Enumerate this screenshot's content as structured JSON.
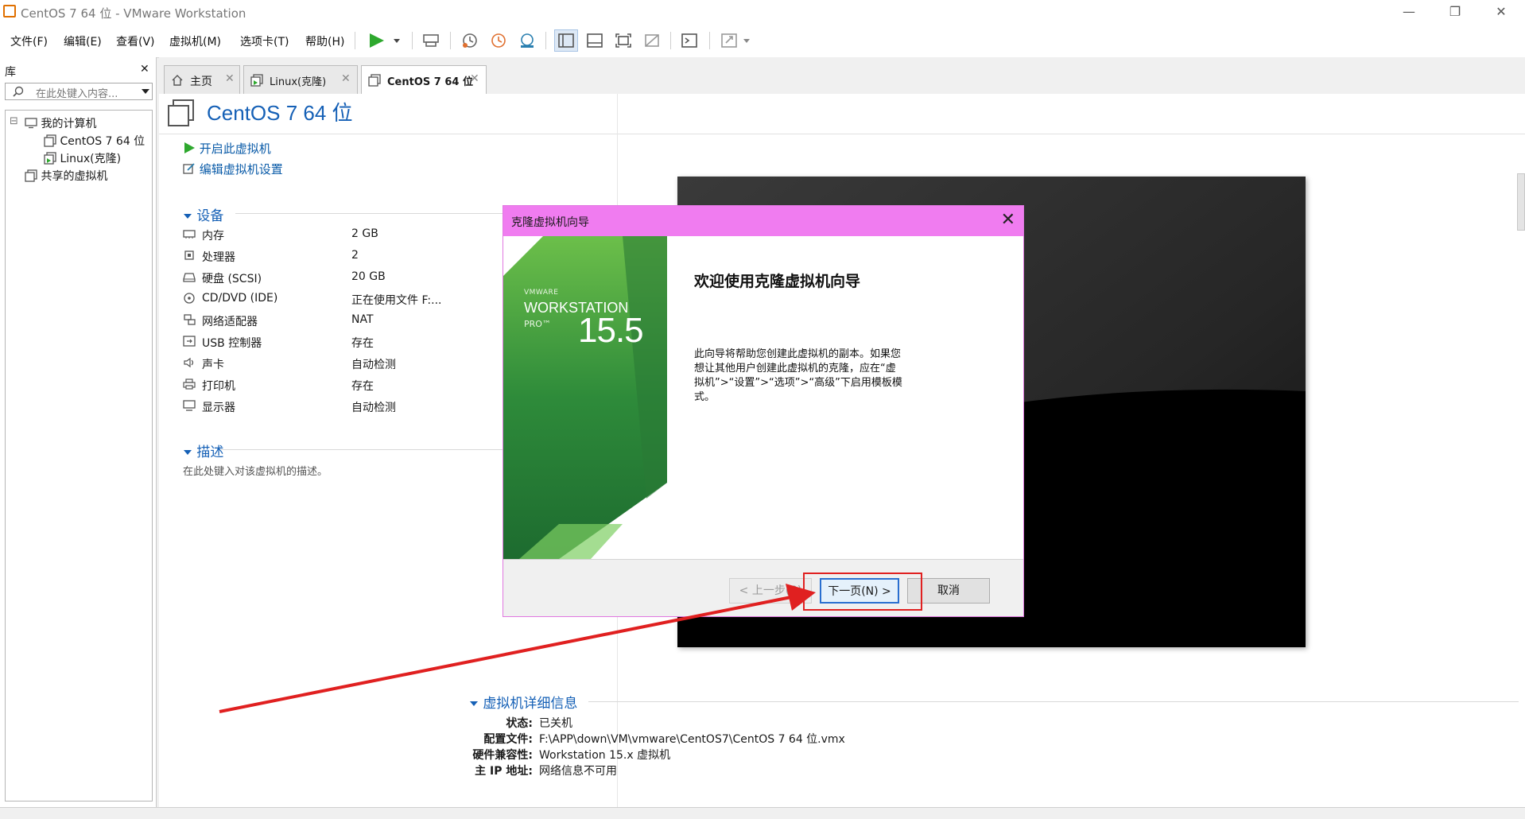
{
  "window": {
    "title": "CentOS 7 64 位 - VMware Workstation",
    "controls": [
      "—",
      "❐",
      "✕"
    ]
  },
  "menu": [
    "文件(F)",
    "编辑(E)",
    "查看(V)",
    "虚拟机(M)",
    "选项卡(T)",
    "帮助(H)"
  ],
  "sidebar": {
    "title": "库",
    "close": "✕",
    "search_placeholder": "在此处键入内容...",
    "tree": {
      "root": "我的计算机",
      "vms": [
        "CentOS 7 64 位",
        "Linux(克隆)"
      ],
      "shared": "共享的虚拟机",
      "toggle": "⊟"
    }
  },
  "tabs": [
    {
      "label": "主页",
      "close": "✕"
    },
    {
      "label": "Linux(克隆)",
      "close": "✕"
    },
    {
      "label": "CentOS 7 64 位",
      "close": "✕",
      "active": true
    }
  ],
  "vm": {
    "name": "CentOS 7 64 位",
    "actions": [
      "开启此虚拟机",
      "编辑虚拟机设置"
    ],
    "devices_title": "设备",
    "devices": [
      {
        "icon": "memory-icon",
        "name": "内存",
        "value": "2 GB"
      },
      {
        "icon": "processor-icon",
        "name": "处理器",
        "value": "2"
      },
      {
        "icon": "hard-disk-icon",
        "name": "硬盘 (SCSI)",
        "value": "20 GB"
      },
      {
        "icon": "cd-dvd-icon",
        "name": "CD/DVD (IDE)",
        "value": "正在使用文件 F:..."
      },
      {
        "icon": "network-adapter-icon",
        "name": "网络适配器",
        "value": "NAT"
      },
      {
        "icon": "usb-controller-icon",
        "name": "USB 控制器",
        "value": "存在"
      },
      {
        "icon": "sound-card-icon",
        "name": "声卡",
        "value": "自动检测"
      },
      {
        "icon": "printer-icon",
        "name": "打印机",
        "value": "存在"
      },
      {
        "icon": "display-icon",
        "name": "显示器",
        "value": "自动检测"
      }
    ],
    "description_title": "描述",
    "description_placeholder": "在此处键入对该虚拟机的描述。",
    "details_title": "虚拟机详细信息",
    "details": [
      {
        "key": "状态:",
        "value": "已关机"
      },
      {
        "key": "配置文件:",
        "value": "F:\\APP\\down\\VM\\vmware\\CentOS7\\CentOS 7 64 位.vmx"
      },
      {
        "key": "硬件兼容性:",
        "value": "Workstation 15.x 虚拟机"
      },
      {
        "key": "主 IP 地址:",
        "value": "网络信息不可用"
      }
    ]
  },
  "dialog": {
    "title": "克隆虚拟机向导",
    "close": "✕",
    "banner": {
      "vendor": "VMWARE",
      "product": "WORKSTATION",
      "edition": "PRO™",
      "version": "15.5"
    },
    "heading": "欢迎使用克隆虚拟机向导",
    "body": "此向导将帮助您创建此虚拟机的副本。如果您想让其他用户创建此虚拟机的克隆，应在“虚拟机”>“设置”>“选项”>“高级”下启用模板模式。",
    "buttons": {
      "back": "< 上一步(B)",
      "next": "下一页(N) >",
      "cancel": "取消"
    }
  },
  "colors": {
    "accent": "#1560b6",
    "dialog_header": "#f07cf0",
    "annotation": "#e02020",
    "banner_green": "#2e8b3a"
  }
}
